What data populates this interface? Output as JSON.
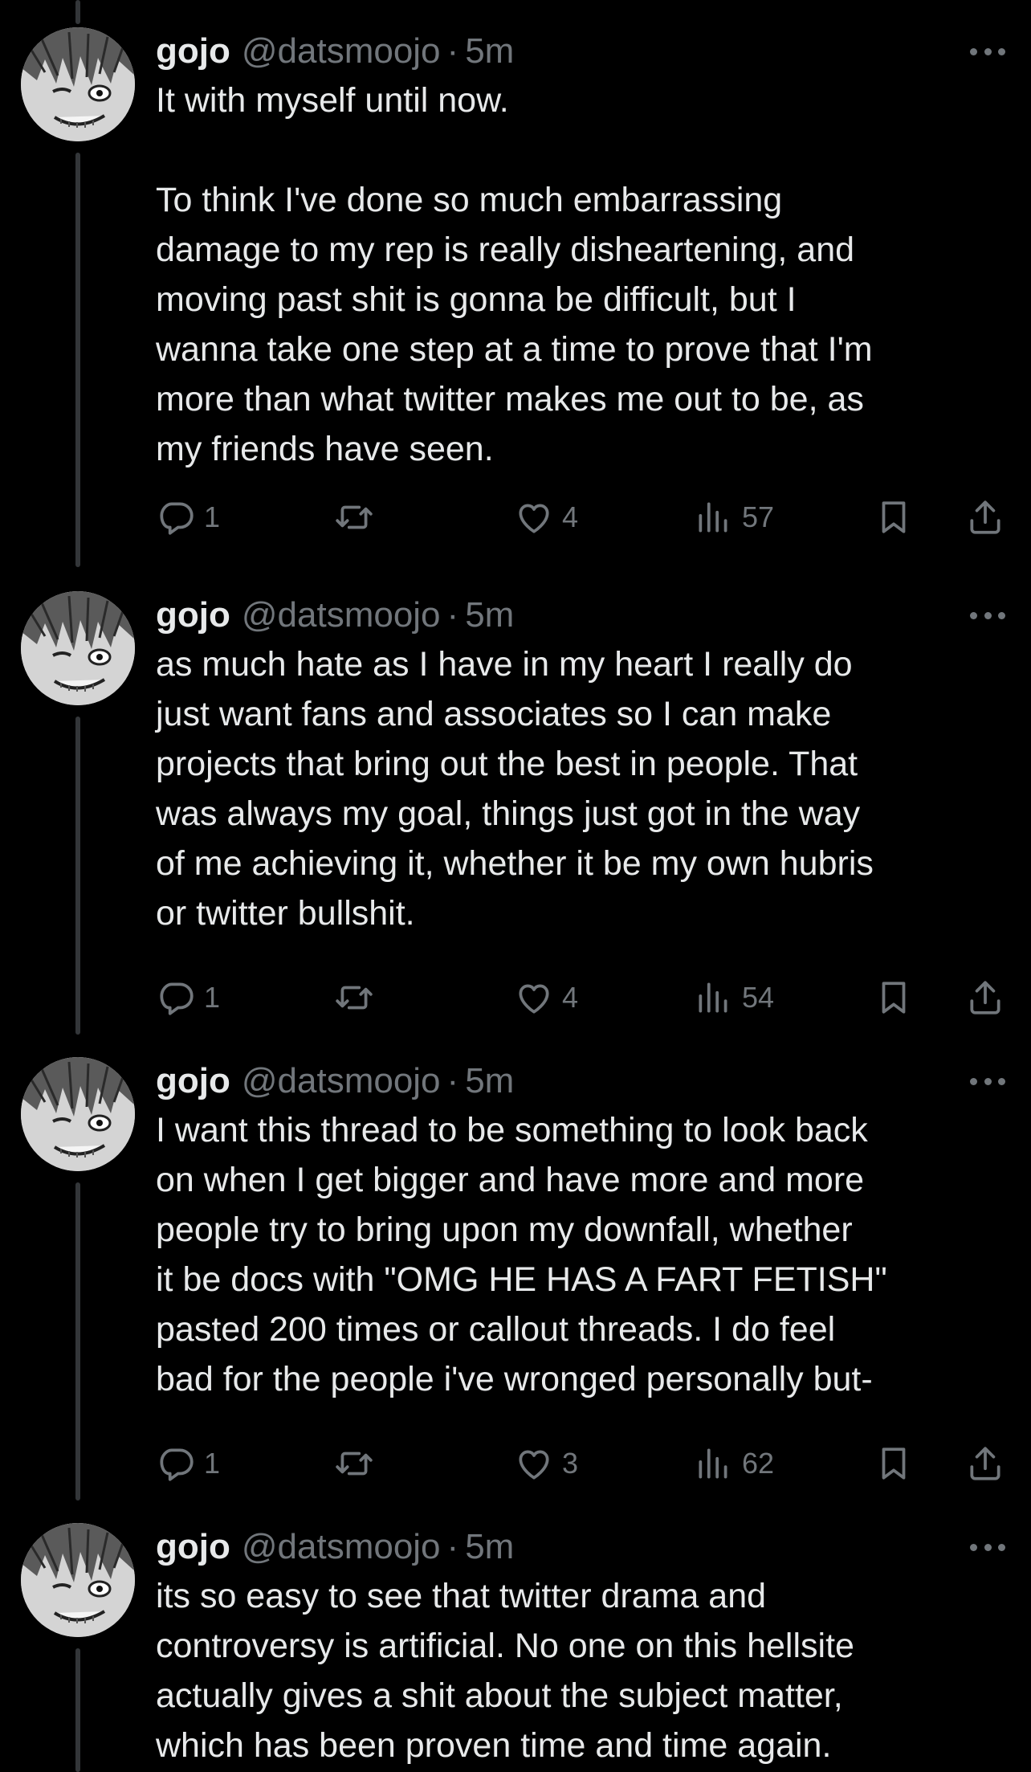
{
  "tweets": [
    {
      "name": "gojo",
      "handle": "@datsmoojo",
      "separator": "·",
      "time": "5m",
      "text": "It with myself until now.\n\nTo think I've done so much embarrassing\ndamage to my rep is really disheartening, and\nmoving past shit is gonna be difficult, but I\nwanna take one step at a time to prove that I'm\nmore than what twitter makes me out to be, as\nmy friends have seen.",
      "replies": "1",
      "retweets": "",
      "likes": "4",
      "views": "57"
    },
    {
      "name": "gojo",
      "handle": "@datsmoojo",
      "separator": "·",
      "time": "5m",
      "text": "as much hate as I have in my heart I really do\njust want fans and associates so I can make\nprojects that bring out the best in people. That\nwas always my goal, things just got in the way\nof me achieving it, whether it be my own hubris\nor twitter bullshit.",
      "replies": "1",
      "retweets": "",
      "likes": "4",
      "views": "54"
    },
    {
      "name": "gojo",
      "handle": "@datsmoojo",
      "separator": "·",
      "time": "5m",
      "text": "I want this thread to be something to look back\non when I get bigger and have more and more\npeople try to bring upon my downfall, whether\nit be docs with \"OMG HE HAS A FART FETISH\"\npasted 200 times or callout threads. I do feel\nbad for the people i've wronged personally but-",
      "replies": "1",
      "retweets": "",
      "likes": "3",
      "views": "62"
    },
    {
      "name": "gojo",
      "handle": "@datsmoojo",
      "separator": "·",
      "time": "5m",
      "text": "its so easy to see that twitter drama and\ncontroversy is artificial. No one on this hellsite\nactually gives a shit about the subject matter,\nwhich has been proven time and time again.",
      "replies": "",
      "retweets": "",
      "likes": "",
      "views": ""
    }
  ],
  "icons": {
    "reply": "reply-icon",
    "retweet": "retweet-icon",
    "like": "heart-icon",
    "views": "views-icon",
    "bookmark": "bookmark-icon",
    "share": "share-icon",
    "more": "more-icon"
  },
  "colors": {
    "background": "#000000",
    "text": "#e7e9ea",
    "secondary": "#71767b",
    "thread_line": "#333639"
  }
}
